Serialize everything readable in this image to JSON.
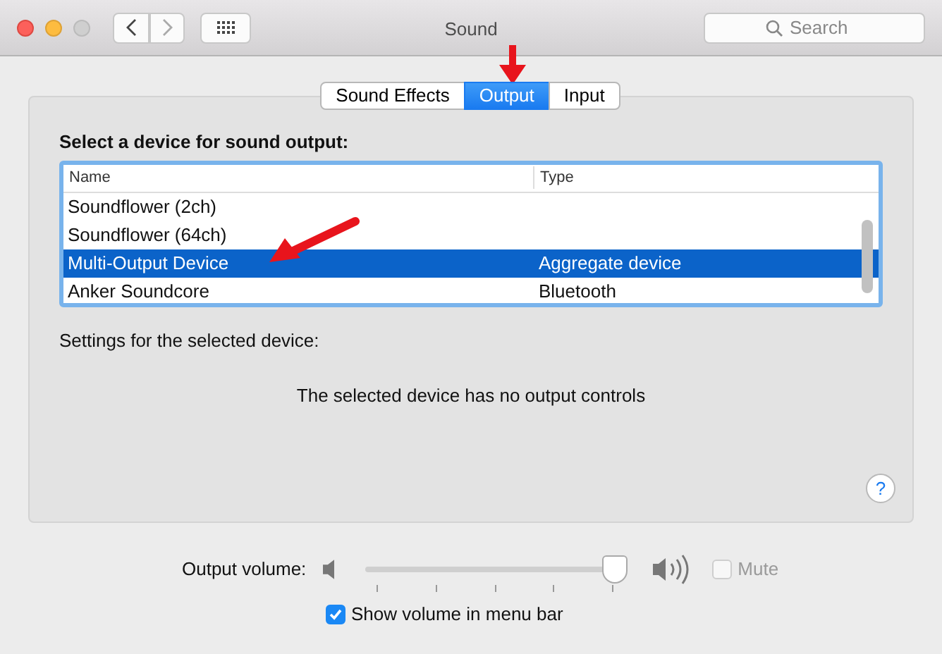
{
  "window": {
    "title": "Sound",
    "search": {
      "placeholder": "Search"
    }
  },
  "tabs": [
    {
      "label": "Sound Effects",
      "selected": false
    },
    {
      "label": "Output",
      "selected": true
    },
    {
      "label": "Input",
      "selected": false
    }
  ],
  "device_list": {
    "heading": "Select a device for sound output:",
    "columns": [
      "Name",
      "Type"
    ],
    "rows": [
      {
        "name": "Soundflower (2ch)",
        "type": "",
        "selected": false
      },
      {
        "name": "Soundflower (64ch)",
        "type": "",
        "selected": false
      },
      {
        "name": "Multi-Output Device",
        "type": "Aggregate device",
        "selected": true
      },
      {
        "name": "Anker Soundcore",
        "type": "Bluetooth",
        "selected": false
      }
    ]
  },
  "settings_label": "Settings for the selected device:",
  "no_controls_message": "The selected device has no output controls",
  "help_button": "?",
  "output_volume": {
    "label": "Output volume:",
    "level": 0.96,
    "mute": {
      "label": "Mute",
      "checked": false,
      "disabled": true
    }
  },
  "show_volume_in_menu_bar": {
    "label": "Show volume in menu bar",
    "checked": true
  }
}
